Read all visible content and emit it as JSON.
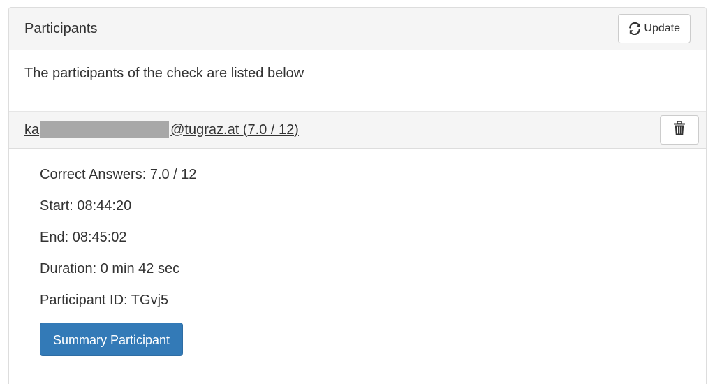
{
  "panel": {
    "title": "Participants",
    "update_button_label": "Update",
    "description": "The participants of the check are listed below"
  },
  "participant": {
    "email_prefix": "ka",
    "email_suffix": "@tugraz.at (7.0 / 12)",
    "details": {
      "correct_answers": "Correct Answers: 7.0 / 12",
      "start": "Start: 08:44:20",
      "end": "End: 08:45:02",
      "duration": "Duration: 0 min 42 sec",
      "participant_id": "Participant ID: TGvj5"
    },
    "summary_button_label": "Summary Participant"
  },
  "icons": {
    "update": "refresh-icon",
    "delete": "trash-icon"
  },
  "colors": {
    "primary": "#337ab7",
    "heading_bg": "#f5f5f5",
    "redaction": "#a8a8a8"
  }
}
